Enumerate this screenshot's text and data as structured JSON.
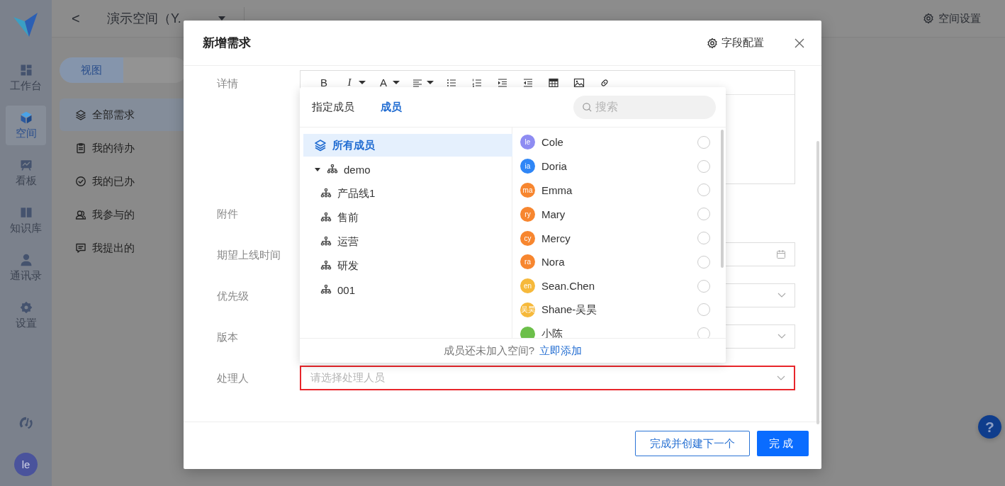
{
  "rail": {
    "items": [
      {
        "label": "工作台",
        "selected": false
      },
      {
        "label": "空间",
        "selected": true
      },
      {
        "label": "看板",
        "selected": false
      },
      {
        "label": "知识库",
        "selected": false
      },
      {
        "label": "通讯录",
        "selected": false
      },
      {
        "label": "设置",
        "selected": false
      }
    ],
    "avatar": "le"
  },
  "space_header": {
    "back": "<",
    "title": "演示空间（Y.",
    "settings": "空间设置"
  },
  "view_switch": [
    {
      "label": "视图",
      "selected": true
    },
    {
      "selected": false
    }
  ],
  "views": [
    {
      "label": "全部需求",
      "selected": true
    },
    {
      "label": "我的待办",
      "selected": false
    },
    {
      "label": "我的已办",
      "selected": false
    },
    {
      "label": "我参与的",
      "selected": false
    },
    {
      "label": "我提出的",
      "selected": false
    }
  ],
  "modal": {
    "title": "新增需求",
    "field_config": "字段配置",
    "toolbar": [
      {
        "kind": "bold",
        "label": "B"
      },
      {
        "kind": "italic",
        "label": "I"
      },
      {
        "kind": "caret"
      },
      {
        "kind": "color",
        "label": "A"
      },
      {
        "kind": "caret"
      },
      {
        "kind": "align"
      },
      {
        "kind": "caret"
      },
      {
        "kind": "bullets"
      },
      {
        "kind": "numbers"
      },
      {
        "kind": "indent"
      },
      {
        "kind": "outdent"
      },
      {
        "kind": "table"
      },
      {
        "kind": "image"
      },
      {
        "kind": "link"
      }
    ],
    "form": [
      {
        "label": "详情",
        "kind": "editor"
      },
      {
        "label": "附件",
        "kind": "attachment"
      },
      {
        "label": "期望上线时间",
        "kind": "date"
      },
      {
        "label": "优先级",
        "kind": "select"
      },
      {
        "label": "版本",
        "kind": "select"
      },
      {
        "label": "处理人",
        "kind": "select",
        "placeholder": "请选择处理人员",
        "error": true
      }
    ],
    "buttons": [
      {
        "label": "完成并创建下一个",
        "kind": "secondary"
      },
      {
        "label": "完成",
        "kind": "primary"
      }
    ]
  },
  "member_picker": {
    "tabs": [
      {
        "label": "指定成员",
        "selected": false
      },
      {
        "label": "成员",
        "selected": true
      }
    ],
    "search": {
      "placeholder": "搜索"
    },
    "groups": [
      {
        "label": "所有成员",
        "kind": "all",
        "selected": true
      },
      {
        "label": "demo",
        "kind": "org",
        "selected": false,
        "expanded": true,
        "children": [
          {
            "label": "产品线1",
            "kind": "org",
            "selected": false
          },
          {
            "label": "售前",
            "kind": "org",
            "selected": false
          },
          {
            "label": "运营",
            "kind": "org",
            "selected": false
          },
          {
            "label": "研发",
            "kind": "org",
            "selected": false
          },
          {
            "label": "001",
            "kind": "org",
            "selected": false
          }
        ]
      }
    ],
    "members": [
      {
        "name": "Cole",
        "avatar": "le",
        "color": "#8e8cf2",
        "selected": false
      },
      {
        "name": "Doria",
        "avatar": "ia",
        "color": "#2f86f6",
        "selected": false
      },
      {
        "name": "Emma",
        "avatar": "ma",
        "color": "#f7862f",
        "selected": false
      },
      {
        "name": "Mary",
        "avatar": "ry",
        "color": "#f7862f",
        "selected": false
      },
      {
        "name": "Mercy",
        "avatar": "cy",
        "color": "#f7862f",
        "selected": false
      },
      {
        "name": "Nora",
        "avatar": "ra",
        "color": "#f7862f",
        "selected": false
      },
      {
        "name": "Sean.Chen",
        "avatar": "en",
        "color": "#f6b93b",
        "selected": false
      },
      {
        "name": "Shane-吴昊",
        "avatar": "吴昊",
        "color": "#f6b93b",
        "selected": false
      },
      {
        "name": "小陈",
        "color": "#6cbf4a",
        "selected": false
      }
    ],
    "footer": {
      "text": "成员还未加入空间?",
      "link": "立即添加"
    }
  },
  "help": "?"
}
